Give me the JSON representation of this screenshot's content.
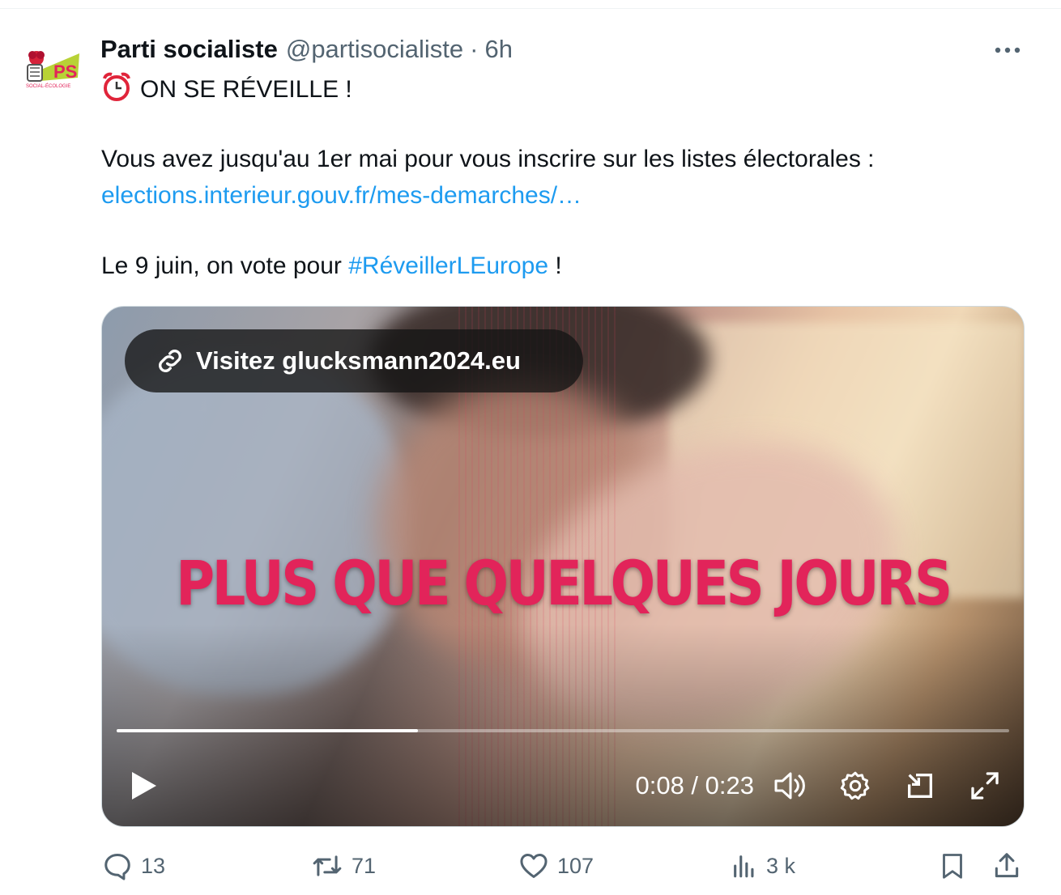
{
  "tweet": {
    "author_name": "Parti socialiste",
    "handle": "@partisocialiste",
    "separator": "·",
    "time": "6h",
    "avatar_logo": {
      "letters": "PS",
      "caption": "SOCIAL-ÉCOLOGIE",
      "colors": {
        "green": "#b8d236",
        "red": "#e2245a",
        "rose": "#d6223a"
      }
    },
    "line1_emoji": "alarm-clock-icon",
    "line1": "ON SE RÉVEILLE !",
    "line2": "Vous avez jusqu'au 1er mai pour vous inscrire sur les listes électorales :",
    "line3_link": "elections.interieur.gouv.fr/mes-demarches/…",
    "line4_prefix": "Le 9 juin, on vote pour",
    "line4_hashtag": "#RéveillerLEurope",
    "line4_suffix": "!"
  },
  "video": {
    "pill_text": "Visitez glucksmann2024.eu",
    "overlay_text": "PLUS QUE QUELQUES JOURS",
    "overlay_color": "#e2245a",
    "progress_fraction": 0.338,
    "timecode": "0:08 / 0:23",
    "controls": [
      "play-icon",
      "volume-icon",
      "settings-icon",
      "pop-out-icon",
      "fullscreen-icon"
    ]
  },
  "actions": {
    "replies": "13",
    "reposts": "71",
    "likes": "107",
    "views": "3 k"
  },
  "colors": {
    "link": "#1d9bf0",
    "muted": "#536471",
    "text": "#0f1419"
  }
}
